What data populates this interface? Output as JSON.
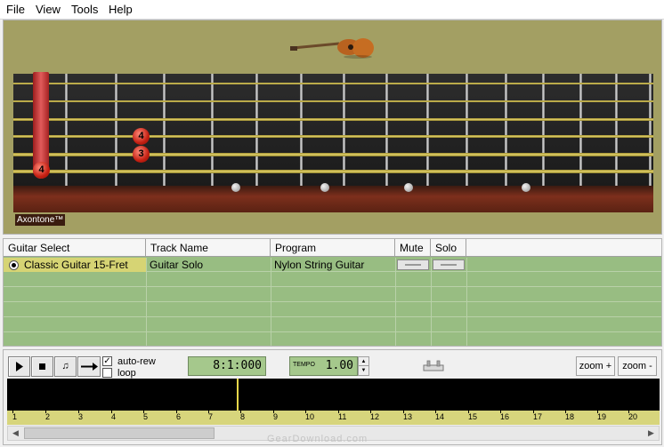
{
  "menu": {
    "file": "File",
    "view": "View",
    "tools": "Tools",
    "help": "Help"
  },
  "guitar_view": {
    "fingers": [
      "4",
      "3",
      "4"
    ],
    "brand": "Axontone™"
  },
  "track_table": {
    "headers": {
      "guitar_select": "Guitar Select",
      "track_name": "Track Name",
      "program": "Program",
      "mute": "Mute",
      "solo": "Solo"
    },
    "rows": [
      {
        "guitar": "Classic Guitar 15-Fret",
        "track": "Guitar Solo",
        "program": "Nylon String Guitar",
        "selected": true
      }
    ]
  },
  "transport": {
    "auto_rewind_label": "auto-rew",
    "auto_rewind_checked": true,
    "loop_label": "loop",
    "loop_checked": false,
    "position": "8:1:000",
    "tempo_label": "TEMPO",
    "tempo": "1.00",
    "zoom_in": "zoom +",
    "zoom_out": "zoom -",
    "checkmark": "✓",
    "unit_glyph": "♫",
    "arrow_left": "◀",
    "arrow_right": "▶",
    "spin_up": "▲",
    "spin_down": "▼"
  },
  "ruler": {
    "ticks": [
      "1",
      "2",
      "3",
      "4",
      "5",
      "6",
      "7",
      "8",
      "9",
      "10",
      "11",
      "12",
      "13",
      "14",
      "15",
      "16",
      "17",
      "18",
      "19",
      "20"
    ],
    "playhead_measure": 8
  },
  "watermark": "GearDownload.com",
  "colors": {
    "panel_olive": "#a39f63",
    "track_green": "#98bd82",
    "selected_cell": "#d6d474",
    "lcd_green": "#a5c88c",
    "ruler_yellow": "#d7d57c"
  }
}
